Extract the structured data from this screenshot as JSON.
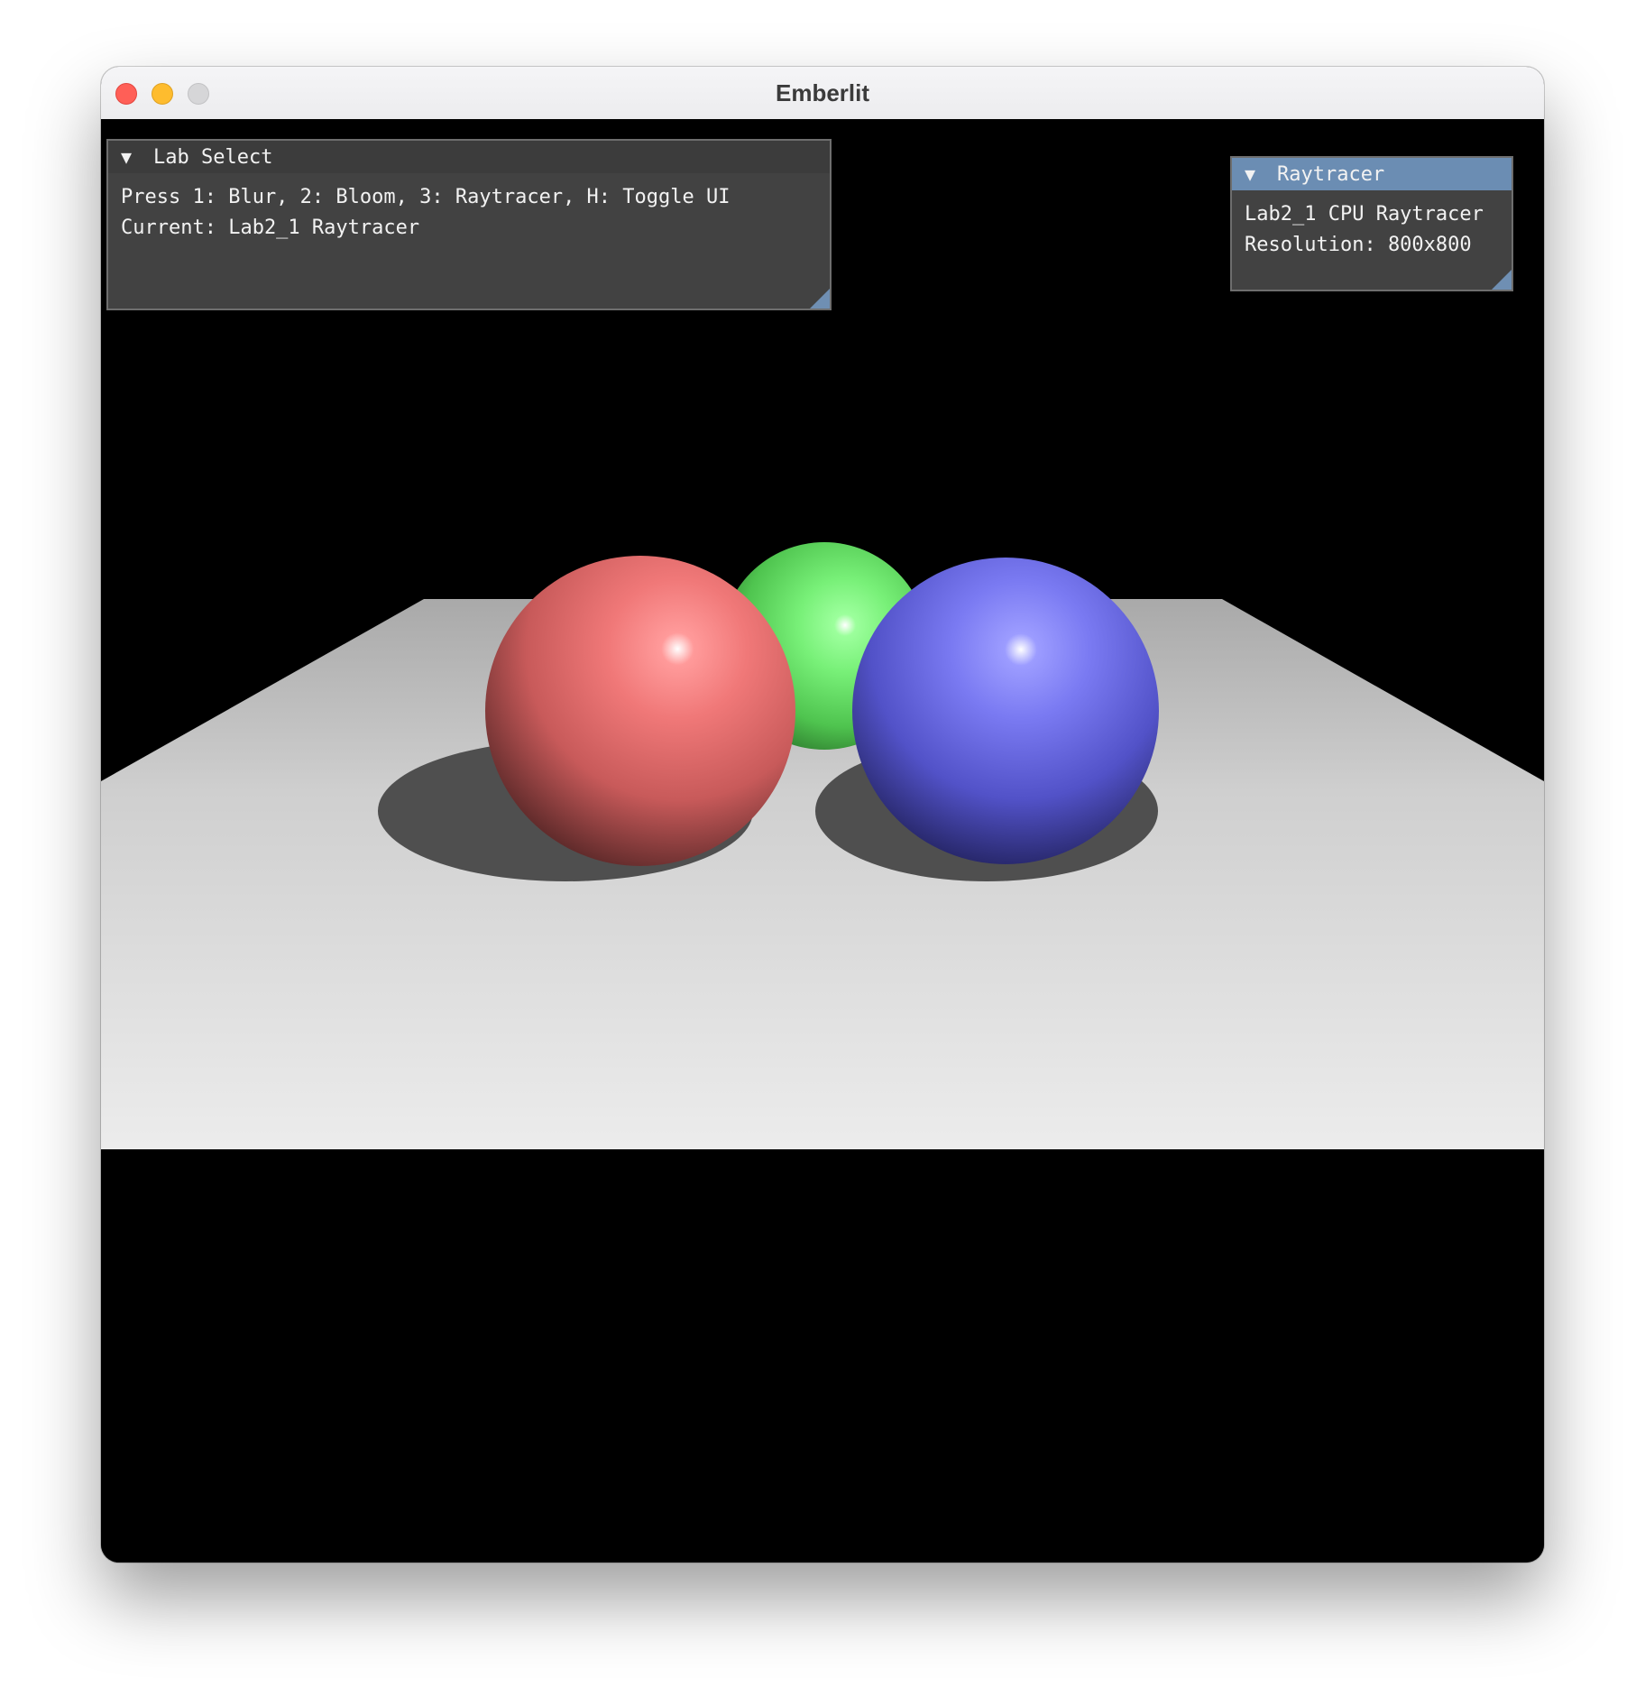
{
  "window": {
    "title": "Emberlit",
    "controls": {
      "close": "close-button",
      "minimize": "minimize-button",
      "zoom": "zoom-button"
    }
  },
  "lab_select": {
    "title": "Lab Select",
    "collapse_icon": "triangle-down-icon",
    "lines": [
      "Press 1: Blur, 2: Bloom, 3: Raytracer, H: Toggle UI",
      "Current: Lab2_1 Raytracer"
    ]
  },
  "raytracer_panel": {
    "title": "Raytracer",
    "collapse_icon": "triangle-down-icon",
    "lines": [
      "Lab2_1 CPU Raytracer",
      "Resolution: 800x800"
    ]
  },
  "scene": {
    "spheres": [
      {
        "name": "red",
        "color": "#e05a5a"
      },
      {
        "name": "green",
        "color": "#4fd84f"
      },
      {
        "name": "blue",
        "color": "#5a5ae6"
      }
    ],
    "floor_color": "#e3e3e3",
    "background": "#000000"
  },
  "colors": {
    "panel_bg": "#464646",
    "panel_header_active": "#6b8db3",
    "panel_header_inactive": "#3c3c3c",
    "panel_text": "#f2f2f2"
  }
}
